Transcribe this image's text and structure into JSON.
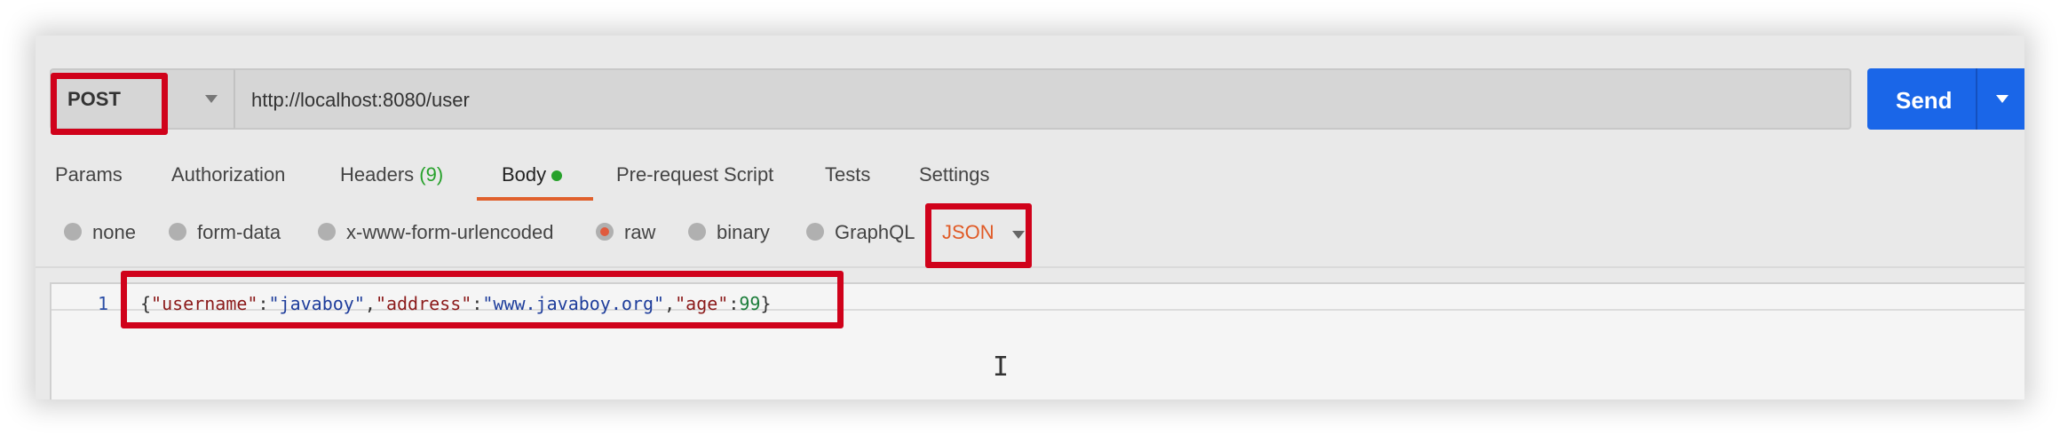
{
  "request": {
    "method": "POST",
    "url": "http://localhost:8080/user",
    "send_label": "Send"
  },
  "tabs": [
    {
      "label": "Params"
    },
    {
      "label": "Authorization"
    },
    {
      "label": "Headers",
      "count": "(9)"
    },
    {
      "label": "Body",
      "active": true
    },
    {
      "label": "Pre-request Script"
    },
    {
      "label": "Tests"
    },
    {
      "label": "Settings"
    }
  ],
  "body_types": [
    {
      "label": "none",
      "checked": false
    },
    {
      "label": "form-data",
      "checked": false
    },
    {
      "label": "x-www-form-urlencoded",
      "checked": false
    },
    {
      "label": "raw",
      "checked": true
    },
    {
      "label": "binary",
      "checked": false
    },
    {
      "label": "GraphQL",
      "checked": false
    }
  ],
  "format": "JSON",
  "editor": {
    "line_number": "1",
    "tokens": {
      "open": "{",
      "k1": "\"username\"",
      "v1": "\"javaboy\"",
      "k2": "\"address\"",
      "v2": "\"www.javaboy.org\"",
      "k3": "\"age\"",
      "v3": "99",
      "colon": ":",
      "comma": ",",
      "close": "}"
    }
  },
  "colors": {
    "accent": "#1a66e8",
    "highlight": "#d0021b",
    "active_tab_underline": "#e0602c",
    "dot_green": "#27a12b"
  }
}
